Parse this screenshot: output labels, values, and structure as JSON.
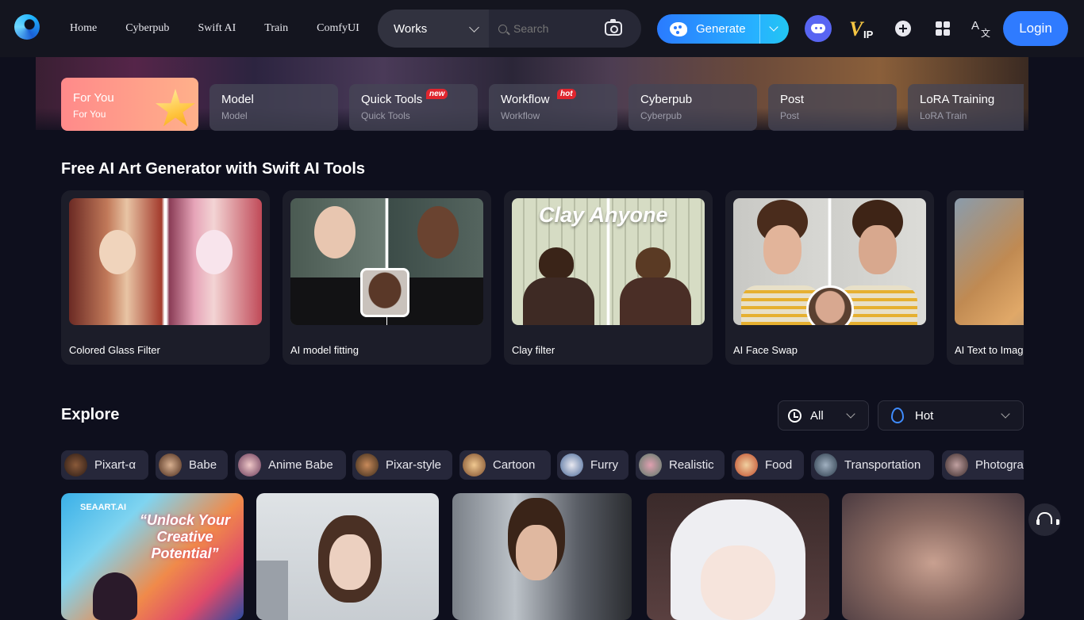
{
  "nav": {
    "links": [
      "Home",
      "Cyberpub",
      "Swift AI",
      "Train",
      "ComfyUI"
    ],
    "search_category": "Works",
    "search_placeholder": "Search",
    "generate_label": "Generate",
    "vip_label_v": "V",
    "vip_label_ip": "IP",
    "lang_a": "A",
    "lang_b": "文",
    "login_label": "Login"
  },
  "categories": [
    {
      "title": "For You",
      "subtitle": "For You",
      "active": true
    },
    {
      "title": "Model",
      "subtitle": "Model"
    },
    {
      "title": "Quick Tools",
      "subtitle": "Quick Tools",
      "badge": "new"
    },
    {
      "title": "Workflow",
      "subtitle": "Workflow",
      "badge": "hot"
    },
    {
      "title": "Cyberpub",
      "subtitle": "Cyberpub"
    },
    {
      "title": "Post",
      "subtitle": "Post"
    },
    {
      "title": "LoRA Training",
      "subtitle": "LoRA Train"
    }
  ],
  "tools_section": {
    "heading": "Free AI Art Generator with Swift AI Tools",
    "cards": [
      {
        "label": "Colored Glass Filter"
      },
      {
        "label": "AI model fitting"
      },
      {
        "label": "Clay filter",
        "overlay": "Clay Anyone"
      },
      {
        "label": "AI Face Swap"
      },
      {
        "label": "AI Text to Image"
      }
    ]
  },
  "explore": {
    "heading": "Explore",
    "time_filter": "All",
    "sort_filter": "Hot",
    "tags": [
      "Pixart-α",
      "Babe",
      "Anime Babe",
      "Pixar-style",
      "Cartoon",
      "Furry",
      "Realistic",
      "Food",
      "Transportation",
      "Photography"
    ]
  },
  "gallery": {
    "first_card_brand": "SEAART.AI",
    "first_card_caption": "“Unlock Your Creative Potential”"
  },
  "colors": {
    "accent": "#2f7bff",
    "background": "#0e0f1d",
    "badge": "#e0262f"
  }
}
